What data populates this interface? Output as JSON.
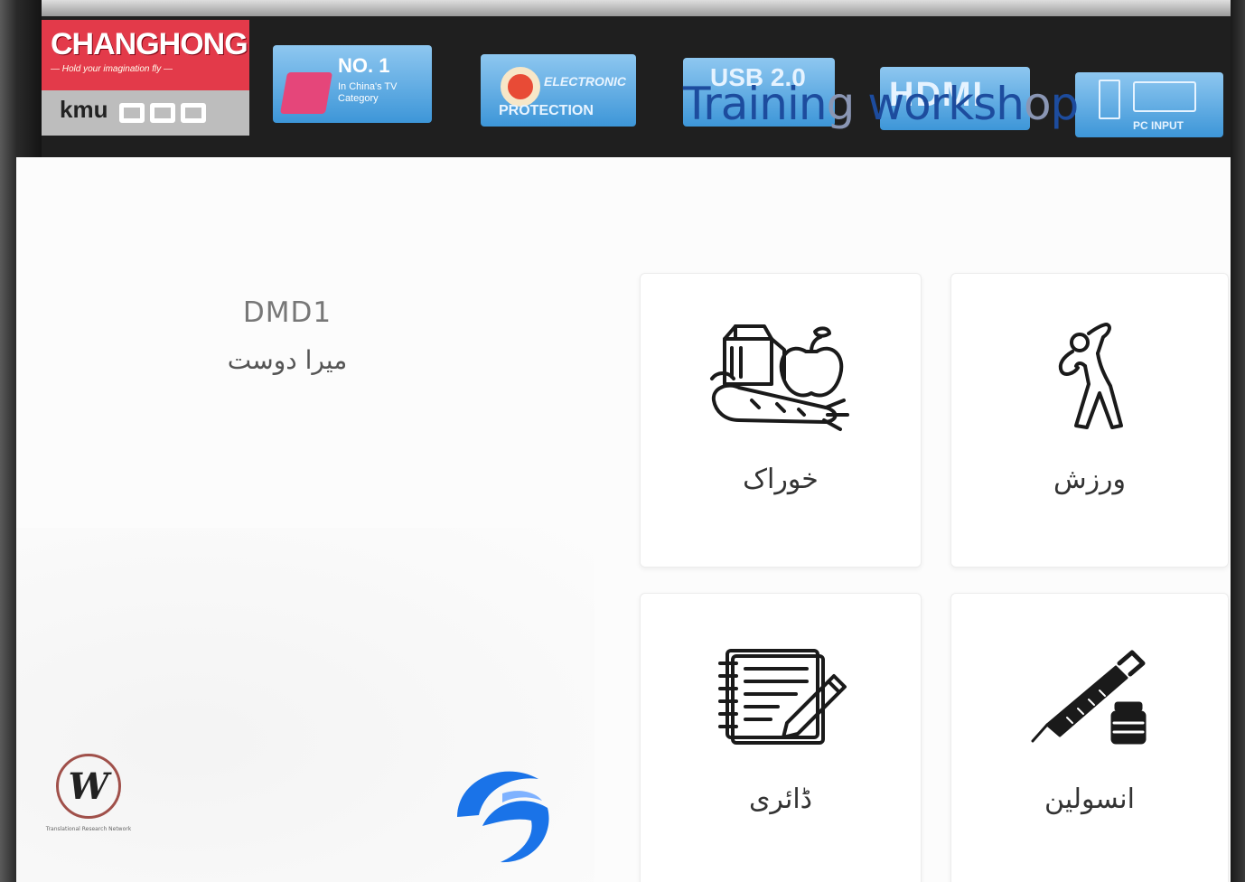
{
  "tv": {
    "brand_name": "CHANGHONG",
    "brand_tagline": "— Hold your imagination fly —",
    "brand_mark": "kmu",
    "stickers": {
      "no1_title": "NO. 1",
      "no1_text": "In China's TV Category",
      "electronic_title": "ELECTRONIC",
      "electronic_bottom": "PROTECTION",
      "usb_title": "USB 2.0",
      "hdmi_title": "HDMI",
      "pc_label": "PC INPUT"
    }
  },
  "overlay_caption": {
    "text_main_1": "Trainin",
    "text_fade_1": "g ",
    "text_main_2": "worksh",
    "text_fade_2": "o",
    "text_main_3": "p"
  },
  "app": {
    "user_name": "DMD1",
    "user_subtitle": "میرا دوست",
    "tiles": [
      {
        "label": "خوراک",
        "icon": "food-icon"
      },
      {
        "label": "ورزش",
        "icon": "exercise-icon"
      },
      {
        "label": "ڈائری",
        "icon": "diary-icon"
      },
      {
        "label": "انسولین",
        "icon": "insulin-icon"
      }
    ],
    "footer_logo_left": {
      "letter": "W",
      "caption": "Translational Research Network"
    },
    "footer_logo_right": "app-logo-icon"
  },
  "colors": {
    "caption_blue": "#1d4c9e",
    "brand_red": "#e33a4a",
    "sticker_blue": "#3d96d8",
    "app_logo_blue": "#1a73e8"
  }
}
